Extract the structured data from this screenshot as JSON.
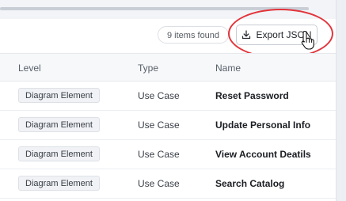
{
  "toolbar": {
    "items_found": "9 items found",
    "export_label": "Export JSON",
    "export_icon": "download-icon"
  },
  "table": {
    "columns": [
      "Level",
      "Type",
      "Name"
    ],
    "rows": [
      {
        "level": "Diagram Element",
        "type": "Use Case",
        "name": "Reset Password"
      },
      {
        "level": "Diagram Element",
        "type": "Use Case",
        "name": "Update Personal Info"
      },
      {
        "level": "Diagram Element",
        "type": "Use Case",
        "name": "View Account Deatils"
      },
      {
        "level": "Diagram Element",
        "type": "Use Case",
        "name": "Search Catalog"
      }
    ]
  },
  "colors": {
    "highlight": "#e2343b",
    "header_bg": "#f7f8fa",
    "tag_bg": "#f0f2f5"
  }
}
